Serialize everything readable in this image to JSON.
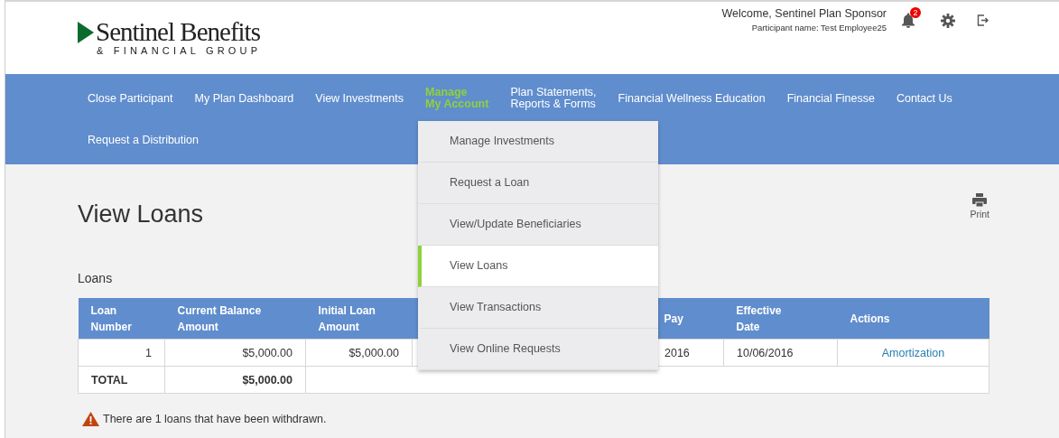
{
  "logo": {
    "name": "Sentinel Benefits",
    "tagline": "& FINANCIAL GROUP"
  },
  "user": {
    "welcome": "Welcome,  Sentinel Plan Sponsor",
    "participant": "Participant name:  Test Employee25",
    "notifications": "2"
  },
  "nav": [
    {
      "label": "Close Participant",
      "selected": false
    },
    {
      "label": "My Plan Dashboard",
      "selected": false
    },
    {
      "label": "View Investments",
      "selected": false
    },
    {
      "label": "Manage\nMy Account",
      "selected": true
    },
    {
      "label": "Plan Statements,\nReports & Forms",
      "selected": false
    },
    {
      "label": "Financial Wellness Education",
      "selected": false
    },
    {
      "label": "Financial Finesse",
      "selected": false
    },
    {
      "label": "Contact Us",
      "selected": false
    },
    {
      "label": "Request a Distribution",
      "selected": false
    }
  ],
  "dropdown": [
    {
      "label": "Manage Investments",
      "selected": false
    },
    {
      "label": "Request a Loan",
      "selected": false
    },
    {
      "label": "View/Update Beneficiaries",
      "selected": false
    },
    {
      "label": "View Loans",
      "selected": true
    },
    {
      "label": "View Transactions",
      "selected": false
    },
    {
      "label": "View Online Requests",
      "selected": false
    }
  ],
  "page_title": "View Loans",
  "print": "Print",
  "section": "Loans",
  "table": {
    "columns": [
      {
        "header": "Loan\nNumber"
      },
      {
        "header": "Current Balance\nAmount"
      },
      {
        "header": "Initial Loan\nAmount"
      },
      {},
      {},
      {
        "header": "Pay"
      },
      {
        "header": "Effective\nDate"
      },
      {
        "header": "Actions"
      }
    ],
    "rows": [
      {
        "cells": [
          {
            "text": "1"
          },
          {
            "text": "$5,000.00"
          },
          {
            "text": "$5,000.00"
          },
          {},
          {},
          {
            "text": "2016"
          },
          {
            "text": "10/06/2016"
          },
          {
            "text": "Amortization",
            "kind": "link"
          }
        ]
      }
    ],
    "total": {
      "label": "TOTAL",
      "amount": "$5,000.00"
    }
  },
  "warning": "There are 1 loans that have been withdrawn."
}
